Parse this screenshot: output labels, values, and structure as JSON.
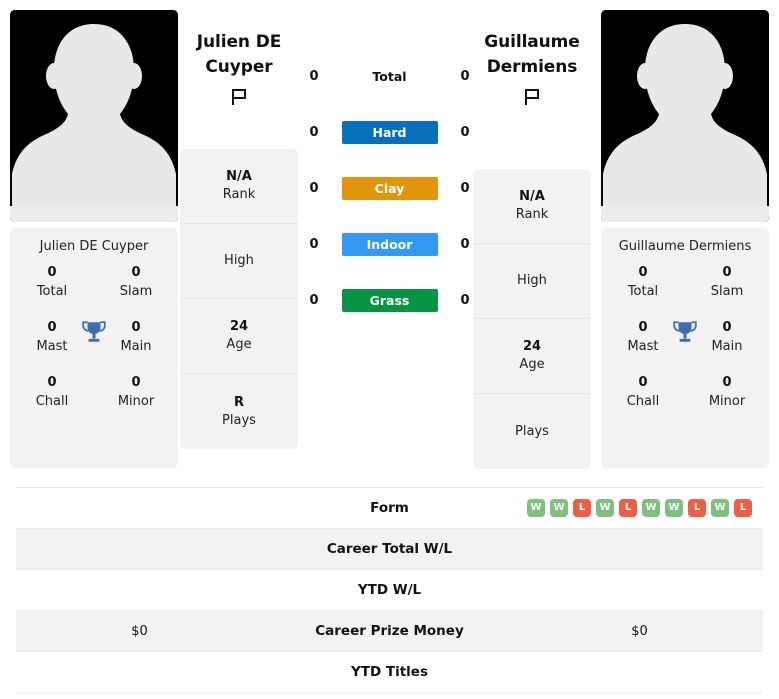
{
  "players": {
    "left": {
      "name": "Julien DE Cuyper",
      "name_line1": "Julien DE",
      "name_line2": "Cuyper",
      "flag_icon": "flag-icon",
      "photo_icon": "player-silhouette-photo",
      "info": [
        {
          "value": "N/A",
          "label": "Rank"
        },
        {
          "value": "",
          "label": "High"
        },
        {
          "value": "24",
          "label": "Age"
        },
        {
          "value": "R",
          "label": "Plays"
        }
      ],
      "titles": [
        {
          "value": "0",
          "label": "Total"
        },
        {
          "value": "0",
          "label": "Slam"
        },
        {
          "value": "0",
          "label": "Mast"
        },
        {
          "value": "0",
          "label": "Main"
        },
        {
          "value": "0",
          "label": "Chall"
        },
        {
          "value": "0",
          "label": "Minor"
        }
      ],
      "trophy_icon": "trophy-icon",
      "surface_counts": [
        "0",
        "0",
        "0",
        "0",
        "0"
      ],
      "form": [],
      "career_total_wl": "",
      "ytd_wl": "",
      "career_prize_money": "$0",
      "ytd_titles": ""
    },
    "right": {
      "name": "Guillaume Dermiens",
      "name_line1": "Guillaume",
      "name_line2": "Dermiens",
      "flag_icon": "flag-icon",
      "photo_icon": "player-silhouette-photo",
      "info": [
        {
          "value": "N/A",
          "label": "Rank"
        },
        {
          "value": "",
          "label": "High"
        },
        {
          "value": "24",
          "label": "Age"
        },
        {
          "value": "",
          "label": "Plays"
        }
      ],
      "titles": [
        {
          "value": "0",
          "label": "Total"
        },
        {
          "value": "0",
          "label": "Slam"
        },
        {
          "value": "0",
          "label": "Mast"
        },
        {
          "value": "0",
          "label": "Main"
        },
        {
          "value": "0",
          "label": "Chall"
        },
        {
          "value": "0",
          "label": "Minor"
        }
      ],
      "trophy_icon": "trophy-icon",
      "surface_counts": [
        "0",
        "0",
        "0",
        "0",
        "0"
      ],
      "form": [
        "W",
        "W",
        "L",
        "W",
        "L",
        "W",
        "W",
        "L",
        "W",
        "L"
      ],
      "career_total_wl": "",
      "ytd_wl": "",
      "career_prize_money": "$0",
      "ytd_titles": ""
    }
  },
  "surfaces": [
    {
      "label": "Total",
      "color": "transparent",
      "text_color": "#111111",
      "plain": true
    },
    {
      "label": "Hard",
      "color": "#0670bd",
      "text_color": "#ffffff",
      "plain": false
    },
    {
      "label": "Clay",
      "color": "#e0950b",
      "text_color": "#ffffff",
      "plain": false
    },
    {
      "label": "Indoor",
      "color": "#3399f3",
      "text_color": "#ffffff",
      "plain": false
    },
    {
      "label": "Grass",
      "color": "#089445",
      "text_color": "#ffffff",
      "plain": false
    }
  ],
  "table_rows": [
    {
      "label": "Form",
      "key": "form",
      "type": "badges"
    },
    {
      "label": "Career Total W/L",
      "key": "career_total_wl",
      "type": "text"
    },
    {
      "label": "YTD W/L",
      "key": "ytd_wl",
      "type": "text"
    },
    {
      "label": "Career Prize Money",
      "key": "career_prize_money",
      "type": "text"
    },
    {
      "label": "YTD Titles",
      "key": "ytd_titles",
      "type": "text"
    }
  ],
  "colors": {
    "win_badge": "#7fbf7f",
    "loss_badge": "#eb5f48",
    "card_bg": "#f2f2f2",
    "trophy": "#3d6fb0"
  }
}
